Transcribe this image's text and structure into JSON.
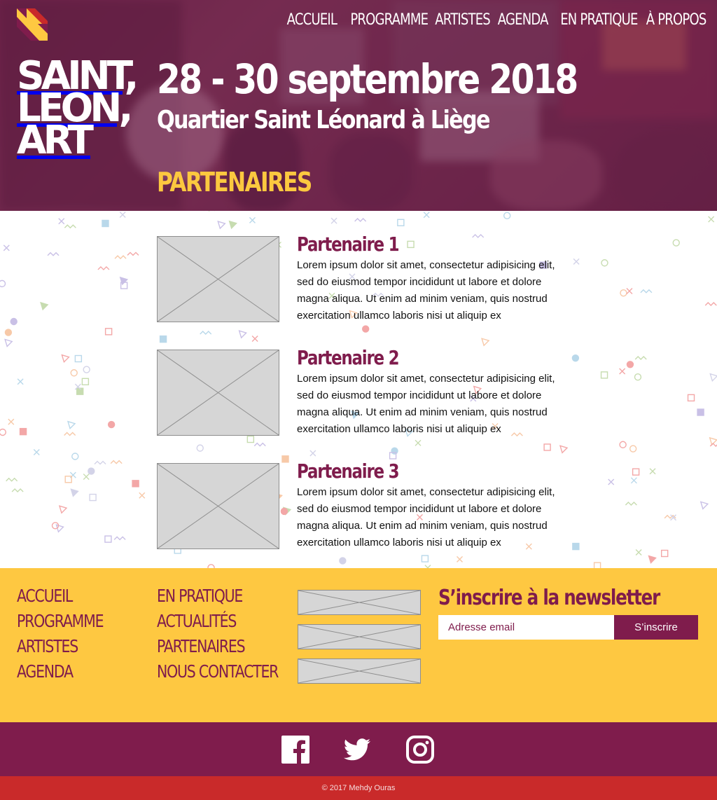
{
  "nav": {
    "items": [
      "ACCUEIL",
      "PROGRAMME",
      "ARTISTES",
      "AGENDA",
      "EN PRATIQUE",
      "À PROPOS"
    ]
  },
  "brand": {
    "lines": [
      "SAINT,",
      "LEON,",
      "ART"
    ]
  },
  "hero": {
    "dates": "28 - 30 septembre 2018",
    "location": "Quartier Saint Léonard à Liège",
    "section_title": "PARTENAIRES"
  },
  "partners": [
    {
      "name": "Partenaire 1",
      "description": "Lorem ipsum dolor sit amet, consectetur adipisicing elit, sed do eiusmod tempor incididunt ut labore et dolore magna aliqua. Ut enim ad minim veniam, quis nostrud exercitation ullamco laboris nisi ut aliquip ex"
    },
    {
      "name": "Partenaire 2",
      "description": "Lorem ipsum dolor sit amet, consectetur adipisicing elit, sed do eiusmod tempor incididunt ut labore et dolore magna aliqua. Ut enim ad minim veniam, quis nostrud exercitation ullamco laboris nisi ut aliquip ex"
    },
    {
      "name": "Partenaire 3",
      "description": "Lorem ipsum dolor sit amet, consectetur adipisicing elit, sed do eiusmod tempor incididunt ut labore et dolore magna aliqua. Ut enim ad minim veniam, quis nostrud exercitation ullamco laboris nisi ut aliquip ex"
    }
  ],
  "footer": {
    "col1": [
      "ACCUEIL",
      "PROGRAMME",
      "ARTISTES",
      "AGENDA"
    ],
    "col2": [
      "EN PRATIQUE",
      "ACTUALITÉS",
      "PARTENAIRES",
      "NOUS CONTACTER"
    ],
    "newsletter": {
      "title": "S’inscrire à la newsletter",
      "placeholder": "Adresse email",
      "button": "S’inscrire"
    }
  },
  "social": {
    "icons": [
      "facebook-icon",
      "twitter-icon",
      "instagram-icon"
    ]
  },
  "copyright": "© 2017 Mehdy Ouras",
  "colors": {
    "primary": "#7f1c4c",
    "accent": "#fec841",
    "footer_bar": "#c92a2a",
    "hero_title_accent": "#fcc83f"
  }
}
